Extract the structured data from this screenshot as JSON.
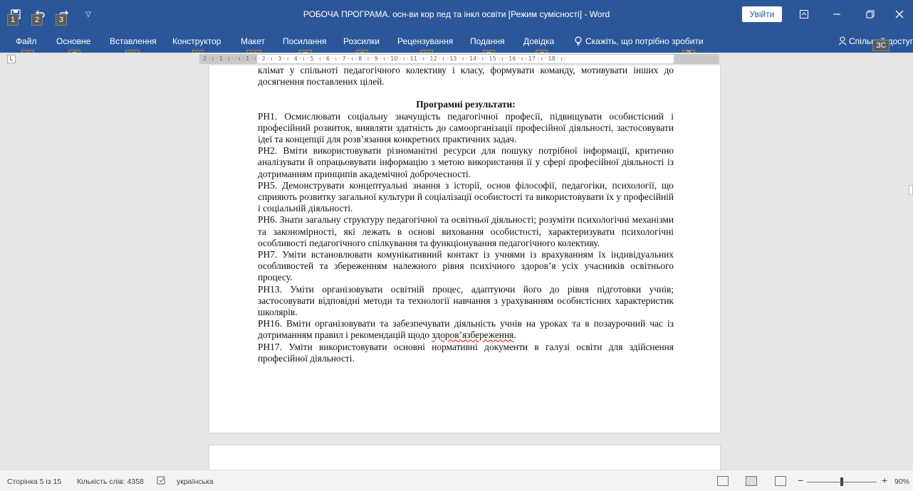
{
  "titlebar": {
    "title": "РОБОЧА ПРОГРАМА. осн-ви кор пед та інкл освіти [Режим сумісності]  -  Word",
    "signin": "Увійти",
    "qat_keytips": [
      "1",
      "2",
      "3"
    ],
    "qat_icons": [
      "save-icon",
      "undo-icon",
      "redo-icon",
      "customize-icon"
    ]
  },
  "menu": {
    "items": [
      {
        "label": "Файл",
        "keytip": "Ф"
      },
      {
        "label": "Основне",
        "keytip": "Е"
      },
      {
        "label": "Вставлення",
        "keytip": "Щ"
      },
      {
        "label": "Конструктор",
        "keytip": "К"
      },
      {
        "label": "Макет",
        "keytip": "Ю"
      },
      {
        "label": "Посилання",
        "keytip": "П"
      },
      {
        "label": "Розсилки",
        "keytip": "Л"
      },
      {
        "label": "Рецензування",
        "keytip": "Ц"
      },
      {
        "label": "Подання",
        "keytip": "Т"
      },
      {
        "label": "Довідка",
        "keytip": "Д"
      }
    ],
    "tell_me": "Скажіть, що потрібно зробити",
    "tell_me_keytip": "Й",
    "share": "Спільний доступ",
    "share_keytip": "ЗС"
  },
  "ruler": {
    "text": "2 · ı · 1 · ı ·   · ı · 1 · ı · 2 · ı · 3 · ı · 4 · ı · 5 · ı · 6 · ı · 7 · ı · 8 · ı · 9 · ı · 10 · ı · 11 · ı · 12 · ı · 13 · ı · 14 · ı · 15 · ı · 16 · ı · 17 · ı · 18 · ı ·"
  },
  "document": {
    "intro": "клімат у спільноті педагогічного колективу і класу, формувати команду, мотивувати інших до досягнення поставлених цілей.",
    "heading": "Програмні результати:",
    "paragraphs": [
      "РН1. Осмислювати соціальну значущість педагогічної професії, підвищувати особистісний і професійний розвиток, виявляти здатність до самоорганізації професійної діяльності, застосовувати ідеї та концепції для розв’язання конкретних практичних задач.",
      "РН2. Вміти використовувати різноманітні ресурси для пошуку потрібної інформації, критично аналізувати й опрацьовувати інформацію з метою використання її у сфері професійної діяльності із дотриманням принципів академічної доброчесності.",
      "РН5. Демонструвати концептуальні знання з історії, основ філософії, педагогіки, психології, що сприяють розвитку загальної культури й соціалізації особистості та  використовувати їх у професійній і соціальній діяльності.",
      "РН6. Знати загальну структуру педагогічної та освітньої діяльності; розуміти психологічні механізми та закономірності, які лежать в основі виховання особистості, характеризувати психологічні особливості педагогічного спілкування та функціонування педагогічного колективу.",
      "РН7. Уміти встановлювати комунікативний контакт із учнями із врахуванням їх індивідуальних особливостей та збереженням належного рівня психічного здоров’я усіх учасників освітнього процесу.",
      "РН13. Уміти організовувати освітній процес, адаптуючи його до рівня підготовки учнів; застосовувати відповідні методи та технології навчання з урахуванням особистісних характеристик школярів."
    ],
    "rn16_start": "РН16. Вміти організовувати та забезпечувати діяльність учнів на уроках та в позаурочний час із дотриманням правил і рекомендацій щодо ",
    "rn16_misspelled": "здоров’язбереження",
    "rn16_end": ".",
    "rn17": "РН17. Уміти використовувати основні нормативні документи в галузі освіти для здійснення професійної діяльності."
  },
  "status": {
    "page": "Сторінка 5 із 15",
    "words": "Кількість слів: 4358",
    "language": "українська",
    "zoom": "90%",
    "zoom_minus": "−",
    "zoom_plus": "+"
  }
}
